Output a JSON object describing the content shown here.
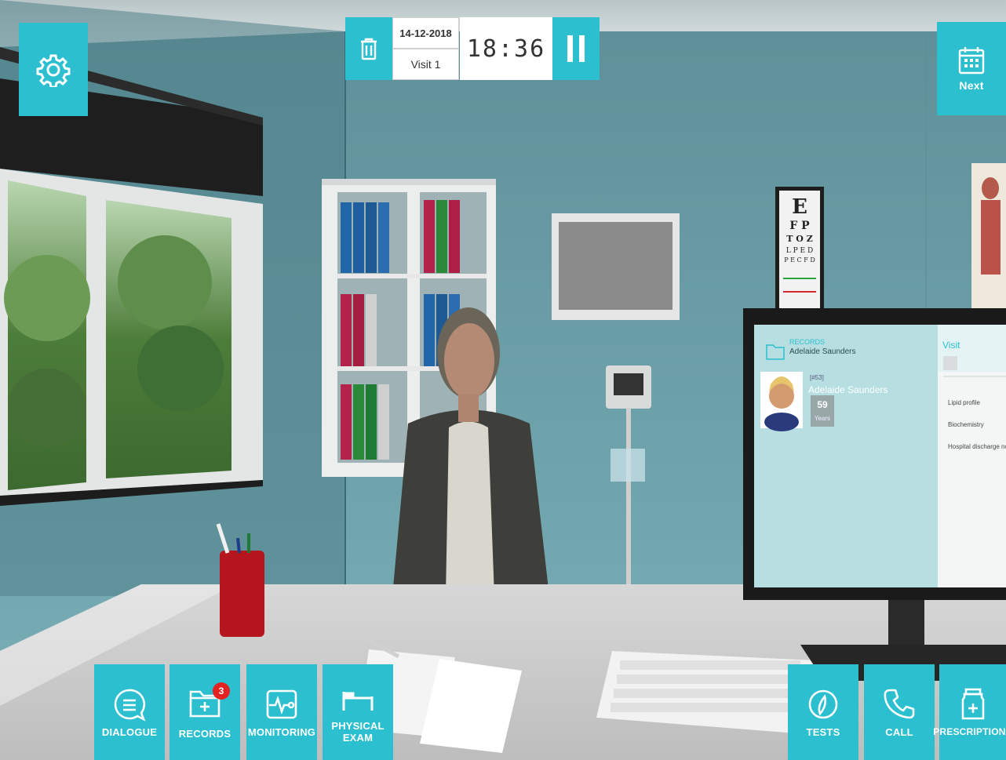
{
  "colors": {
    "accent": "#2bbfcf",
    "wall": "#6e9ea6",
    "badge": "#e32222"
  },
  "session": {
    "date": "14-12-2018",
    "visit": "Visit 1",
    "clock": "18:36"
  },
  "top": {
    "settings_icon": "gear-icon",
    "delete_icon": "trash-icon",
    "pause_icon": "pause-icon",
    "next_icon": "calendar-icon",
    "next_label": "Next"
  },
  "monitor": {
    "section_title": "RECORDS",
    "patient_header": "Adelaide Saunders",
    "patient_id": "[#53]",
    "patient_name": "Adelaide Saunders",
    "age_value": "59",
    "age_unit": "Years",
    "visit_tab": "Visit",
    "records": [
      "Lipid profile",
      "Biochemistry",
      "Hospital discharge not"
    ]
  },
  "toolbar": {
    "dialogue_label": "DIALOGUE",
    "records_label": "RECORDS",
    "records_badge": "3",
    "monitoring_label": "MONITORING",
    "physical_exam_label": "PHYSICAL\nEXAM",
    "tests_label": "TESTS",
    "call_label": "CALL",
    "prescriptions_label": "PRESCRIPTIONS"
  }
}
